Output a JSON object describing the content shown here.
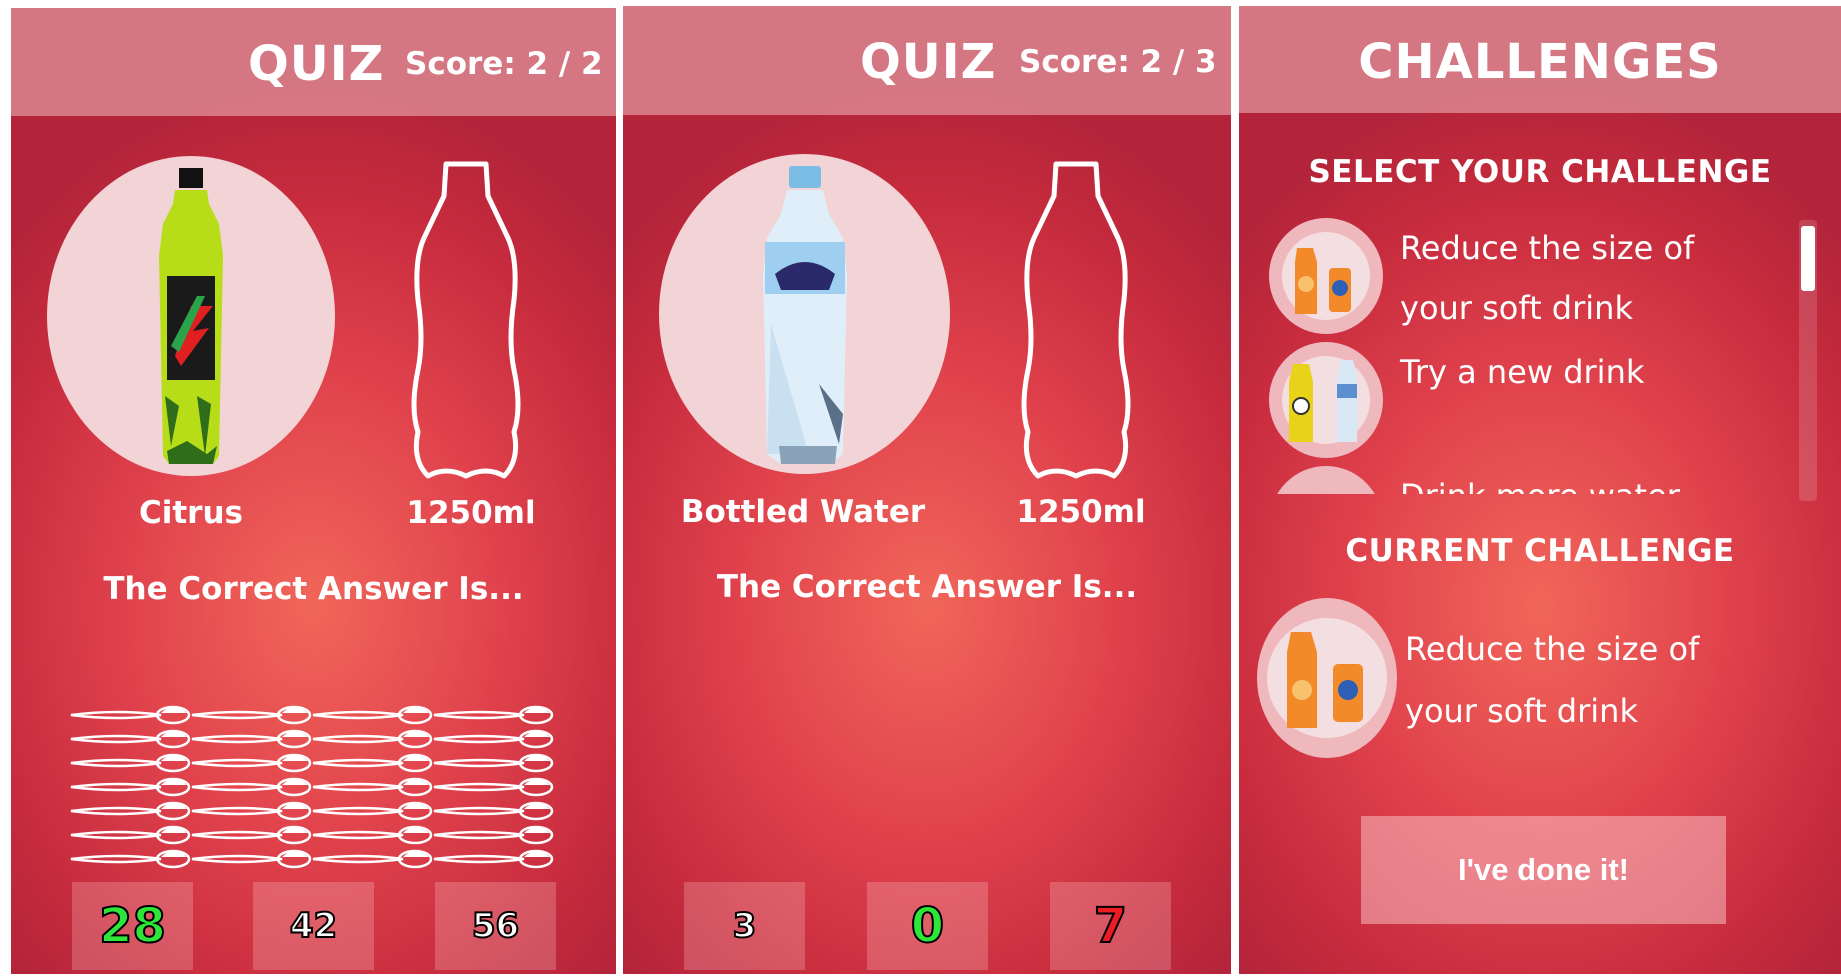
{
  "panels": [
    {
      "header": {
        "title": "QUIZ",
        "score": "Score: 2 / 2"
      },
      "drink_label": "Citrus",
      "size_label": "1250ml",
      "answer_text": "The Correct Answer Is...",
      "options": [
        "28",
        "42",
        "56"
      ],
      "correct_option": "28",
      "sugar_spoons_shown": 28
    },
    {
      "header": {
        "title": "QUIZ",
        "score": "Score: 2 / 3"
      },
      "drink_label": "Bottled Water",
      "size_label": "1250ml",
      "answer_text": "The Correct Answer Is...",
      "options": [
        "3",
        "0",
        "7"
      ],
      "correct_option": "0",
      "wrong_option": "7"
    },
    {
      "header": {
        "title": "CHALLENGES"
      },
      "select_title": "SELECT YOUR CHALLENGE",
      "challenges": [
        {
          "label": "Reduce the size of your soft drink",
          "icon": "bottle-and-can-icon"
        },
        {
          "label": "Try a new drink",
          "icon": "soda-and-water-icon"
        },
        {
          "label": "Drink more water",
          "icon": "water-bottle-icon"
        }
      ],
      "current_title": "CURRENT CHALLENGE",
      "current_challenge": {
        "label": "Reduce the size of your soft drink",
        "icon": "bottle-and-can-icon"
      },
      "done_button": "I've done it!"
    }
  ],
  "colors": {
    "background_center": "#f1665a",
    "background_edge": "#b3243a",
    "correct": "#2ee63a",
    "wrong": "#ee1b22"
  }
}
